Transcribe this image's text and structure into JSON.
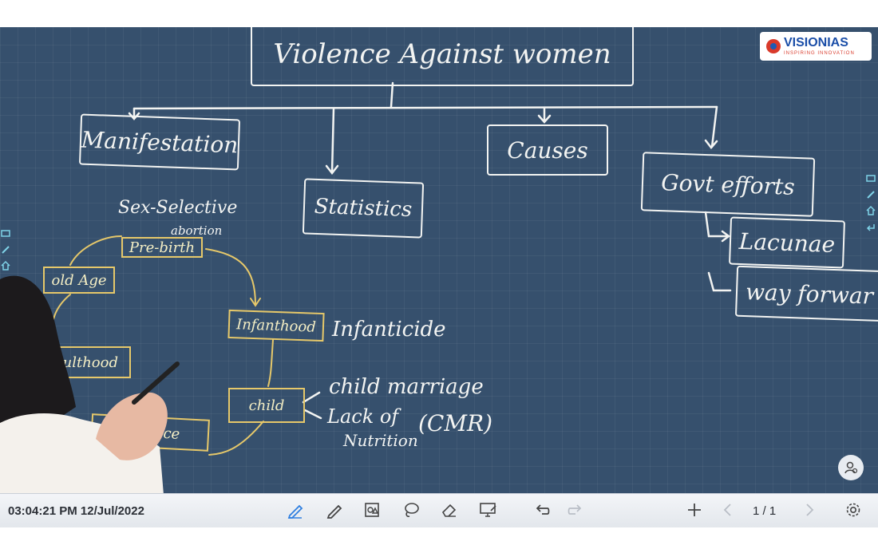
{
  "board": {
    "title": "Violence Against women",
    "branches": {
      "manifestation": "Manifestation",
      "statistics": "Statistics",
      "causes": "Causes",
      "govt_efforts": "Govt efforts"
    },
    "govt_sub": {
      "lacunae": "Lacunae",
      "way_forward": "way forwar"
    },
    "cycle": {
      "pre_birth": "Pre-birth",
      "infanthood": "Infanthood",
      "child": "child",
      "adolescence": "adols    ce",
      "adulthood": "ulthood",
      "old_age": "old Age"
    },
    "notes": {
      "sex_selective": "Sex-Selective",
      "abortion": "abortion",
      "infanticide": "Infanticide",
      "child_marriage": "child marriage",
      "lack_of": "Lack of",
      "nutrition": "Nutrition",
      "cmr": "(CMR)"
    }
  },
  "logo": {
    "name": "VISIONIAS",
    "tagline": "INSPIRING INNOVATION"
  },
  "status": {
    "timestamp": "03:04:21 PM 12/Jul/2022"
  },
  "pager": {
    "page_label": "1 / 1"
  },
  "toolbar": {
    "tools": [
      "pen-icon",
      "pencil-icon",
      "shapes-icon",
      "lasso-icon",
      "eraser-icon",
      "screen-capture-icon",
      "undo-icon",
      "redo-icon",
      "add-page-icon",
      "prev-page-icon",
      "next-page-icon",
      "settings-icon"
    ]
  },
  "colors": {
    "board": "#36506d",
    "chalk": "#f3f4f2",
    "highlight": "#e6c86a",
    "brand_blue": "#1a4ea8",
    "brand_red": "#d93a2b"
  }
}
